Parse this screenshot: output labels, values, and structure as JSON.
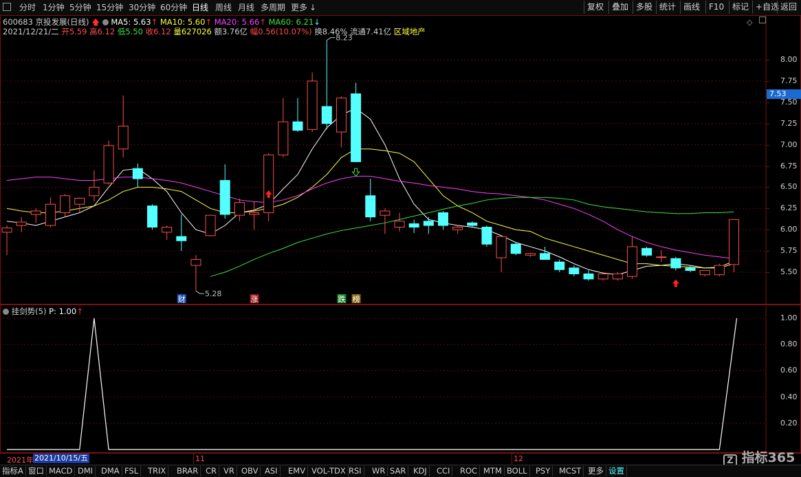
{
  "toolbar": {
    "periods": [
      "分时",
      "1分钟",
      "5分钟",
      "15分钟",
      "30分钟",
      "60分钟",
      "日线",
      "周线",
      "月线",
      "多周期",
      "更多"
    ],
    "active": "日线",
    "right_buttons": [
      "复权",
      "叠加",
      "多股",
      "统计",
      "画线",
      "F10",
      "标记",
      "+自选",
      "返回"
    ]
  },
  "stock": {
    "code_name": "600683 京投发展(日线)",
    "ma5": "MA5: 5.63",
    "ma10": "MA10: 5.60",
    "ma20": "MA20: 5.66",
    "ma60": "MA60: 6.21",
    "date": "2021/12/21/二",
    "open": "开5.59",
    "high": "高6.12",
    "low": "低5.50",
    "close": "收6.12",
    "volume": "量627026",
    "amount": "额3.76亿",
    "change": "幅0.56(10.07%)",
    "turnover": "换8.46%",
    "float": "流通7.41亿",
    "sector": "区域地产"
  },
  "price_axis": {
    "ticks": [
      "8.00",
      "7.75",
      "7.50",
      "7.25",
      "7.00",
      "6.75",
      "6.50",
      "6.25",
      "6.00",
      "5.75",
      "5.50"
    ],
    "current": "7.53"
  },
  "annotations": {
    "high": "8.23",
    "low": "5.28",
    "tags": [
      "财",
      "涨",
      "跌",
      "榜"
    ]
  },
  "indicator": {
    "title": "挂剑势(5)",
    "param": "P: 1.00",
    "ticks": [
      "1.00",
      "0.80",
      "0.60",
      "0.40",
      "0.20"
    ]
  },
  "time_axis": {
    "year": "2021年",
    "cursor_date": "2021/10/15/五",
    "months": [
      "11",
      "12"
    ]
  },
  "bottom_tabs": [
    "指标A",
    "窗口",
    "MACD",
    "DMI",
    "DMA",
    "FSL",
    "TRIX",
    "BRAR",
    "CR",
    "VR",
    "OBV",
    "ASI",
    "EMV",
    "VOL-TDX",
    "RSI",
    "WR",
    "SAR",
    "KDJ",
    "CCI",
    "ROC",
    "MTM",
    "BOLL",
    "PSY",
    "MCST",
    "更多",
    "设置"
  ],
  "watermark": "指标365",
  "colors": {
    "up": "#ff4d4d",
    "down": "#54ffff",
    "ma5": "#ffffff",
    "ma10": "#ffff40",
    "ma20": "#ff40ff",
    "ma60": "#40e040",
    "frame": "#7a1010"
  },
  "chart_data": {
    "type": "candlestick",
    "candles": [
      {
        "o": 5.97,
        "h": 6.05,
        "l": 5.7,
        "c": 6.02
      },
      {
        "o": 6.05,
        "h": 6.15,
        "l": 5.97,
        "c": 6.09
      },
      {
        "o": 6.18,
        "h": 6.25,
        "l": 6.08,
        "c": 6.22
      },
      {
        "o": 6.05,
        "h": 6.38,
        "l": 6.03,
        "c": 6.3
      },
      {
        "o": 6.2,
        "h": 6.42,
        "l": 6.15,
        "c": 6.4
      },
      {
        "o": 6.3,
        "h": 6.38,
        "l": 6.2,
        "c": 6.37
      },
      {
        "o": 6.4,
        "h": 6.7,
        "l": 6.33,
        "c": 6.5
      },
      {
        "o": 6.55,
        "h": 7.05,
        "l": 6.53,
        "c": 6.99
      },
      {
        "o": 6.95,
        "h": 7.58,
        "l": 6.85,
        "c": 7.22
      },
      {
        "o": 6.72,
        "h": 6.78,
        "l": 6.5,
        "c": 6.6
      },
      {
        "o": 6.28,
        "h": 6.3,
        "l": 6.0,
        "c": 6.03
      },
      {
        "o": 5.97,
        "h": 6.05,
        "l": 5.88,
        "c": 6.03
      },
      {
        "o": 5.92,
        "h": 6.18,
        "l": 5.75,
        "c": 5.87
      },
      {
        "o": 5.58,
        "h": 5.7,
        "l": 5.28,
        "c": 5.65
      },
      {
        "o": 5.93,
        "h": 6.1,
        "l": 5.92,
        "c": 6.17
      },
      {
        "o": 6.58,
        "h": 6.77,
        "l": 6.13,
        "c": 6.18
      },
      {
        "o": 6.17,
        "h": 6.37,
        "l": 6.1,
        "c": 6.32
      },
      {
        "o": 6.18,
        "h": 6.33,
        "l": 6.0,
        "c": 6.2
      },
      {
        "o": 6.2,
        "h": 6.9,
        "l": 6.1,
        "c": 6.88
      },
      {
        "o": 6.88,
        "h": 7.55,
        "l": 6.85,
        "c": 7.27
      },
      {
        "o": 7.27,
        "h": 7.55,
        "l": 7.15,
        "c": 7.17
      },
      {
        "o": 7.18,
        "h": 7.85,
        "l": 7.15,
        "c": 7.75
      },
      {
        "o": 7.45,
        "h": 8.23,
        "l": 7.18,
        "c": 7.25
      },
      {
        "o": 7.15,
        "h": 7.57,
        "l": 6.97,
        "c": 7.55
      },
      {
        "o": 7.6,
        "h": 7.73,
        "l": 6.8,
        "c": 6.8
      },
      {
        "o": 6.4,
        "h": 6.6,
        "l": 6.1,
        "c": 6.15
      },
      {
        "o": 6.17,
        "h": 6.25,
        "l": 5.95,
        "c": 6.22
      },
      {
        "o": 6.03,
        "h": 6.2,
        "l": 5.98,
        "c": 6.1
      },
      {
        "o": 6.07,
        "h": 6.12,
        "l": 5.96,
        "c": 6.03
      },
      {
        "o": 6.1,
        "h": 6.15,
        "l": 5.95,
        "c": 6.05
      },
      {
        "o": 6.2,
        "h": 6.22,
        "l": 6.0,
        "c": 6.05
      },
      {
        "o": 6.0,
        "h": 6.05,
        "l": 5.95,
        "c": 6.03
      },
      {
        "o": 6.08,
        "h": 6.1,
        "l": 6.03,
        "c": 6.05
      },
      {
        "o": 6.03,
        "h": 6.05,
        "l": 5.8,
        "c": 5.83
      },
      {
        "o": 5.67,
        "h": 5.87,
        "l": 5.5,
        "c": 5.92
      },
      {
        "o": 5.83,
        "h": 5.85,
        "l": 5.7,
        "c": 5.72
      },
      {
        "o": 5.7,
        "h": 5.73,
        "l": 5.68,
        "c": 5.72
      },
      {
        "o": 5.72,
        "h": 5.8,
        "l": 5.67,
        "c": 5.65
      },
      {
        "o": 5.62,
        "h": 5.65,
        "l": 5.5,
        "c": 5.53
      },
      {
        "o": 5.55,
        "h": 5.58,
        "l": 5.45,
        "c": 5.48
      },
      {
        "o": 5.48,
        "h": 5.52,
        "l": 5.4,
        "c": 5.42
      },
      {
        "o": 5.42,
        "h": 5.5,
        "l": 5.4,
        "c": 5.48
      },
      {
        "o": 5.42,
        "h": 5.5,
        "l": 5.4,
        "c": 5.48
      },
      {
        "o": 5.45,
        "h": 5.92,
        "l": 5.42,
        "c": 5.8
      },
      {
        "o": 5.78,
        "h": 5.8,
        "l": 5.68,
        "c": 5.7
      },
      {
        "o": 5.68,
        "h": 5.76,
        "l": 5.62,
        "c": 5.68
      },
      {
        "o": 5.66,
        "h": 5.68,
        "l": 5.52,
        "c": 5.55
      },
      {
        "o": 5.55,
        "h": 5.58,
        "l": 5.5,
        "c": 5.52
      },
      {
        "o": 5.47,
        "h": 5.52,
        "l": 5.45,
        "c": 5.52
      },
      {
        "o": 5.47,
        "h": 5.6,
        "l": 5.45,
        "c": 5.58
      },
      {
        "o": 5.59,
        "h": 6.12,
        "l": 5.5,
        "c": 6.12
      }
    ],
    "ma5": [
      6.1,
      6.08,
      6.05,
      6.1,
      6.15,
      6.2,
      6.28,
      6.5,
      6.7,
      6.72,
      6.6,
      6.45,
      6.2,
      6.0,
      5.95,
      6.05,
      6.2,
      6.23,
      6.3,
      6.48,
      6.65,
      6.95,
      7.2,
      7.35,
      7.43,
      7.3,
      7.0,
      6.6,
      6.3,
      6.12,
      6.08,
      6.05,
      6.03,
      6.0,
      5.93,
      5.85,
      5.8,
      5.75,
      5.68,
      5.6,
      5.53,
      5.49,
      5.47,
      5.52,
      5.57,
      5.58,
      5.6,
      5.58,
      5.55,
      5.56,
      5.63
    ],
    "ma10": [
      6.25,
      6.22,
      6.2,
      6.2,
      6.22,
      6.25,
      6.28,
      6.35,
      6.45,
      6.5,
      6.5,
      6.48,
      6.45,
      6.35,
      6.25,
      6.2,
      6.2,
      6.22,
      6.25,
      6.3,
      6.38,
      6.5,
      6.65,
      6.85,
      6.95,
      6.95,
      6.93,
      6.9,
      6.8,
      6.6,
      6.4,
      6.28,
      6.2,
      6.1,
      6.05,
      6.0,
      5.98,
      5.9,
      5.85,
      5.8,
      5.75,
      5.7,
      5.65,
      5.6,
      5.6,
      5.58,
      5.57,
      5.56,
      5.55,
      5.55,
      5.6
    ],
    "ma20": [
      6.58,
      6.6,
      6.62,
      6.62,
      6.6,
      6.58,
      6.58,
      6.6,
      6.62,
      6.62,
      6.6,
      6.58,
      6.55,
      6.5,
      6.45,
      6.4,
      6.35,
      6.33,
      6.32,
      6.35,
      6.4,
      6.48,
      6.55,
      6.6,
      6.63,
      6.63,
      6.6,
      6.57,
      6.55,
      6.52,
      6.5,
      6.48,
      6.45,
      6.43,
      6.42,
      6.4,
      6.38,
      6.35,
      6.3,
      6.25,
      6.18,
      6.1,
      6.0,
      5.92,
      5.85,
      5.8,
      5.76,
      5.73,
      5.7,
      5.68,
      5.66
    ],
    "ma60": [
      null,
      null,
      null,
      null,
      null,
      null,
      null,
      null,
      null,
      null,
      null,
      null,
      null,
      null,
      5.45,
      5.5,
      5.57,
      5.65,
      5.72,
      5.78,
      5.85,
      5.9,
      5.95,
      5.99,
      6.02,
      6.05,
      6.08,
      6.12,
      6.16,
      6.2,
      6.24,
      6.28,
      6.31,
      6.35,
      6.37,
      6.38,
      6.38,
      6.38,
      6.37,
      6.35,
      6.3,
      6.27,
      6.25,
      6.23,
      6.21,
      6.2,
      6.19,
      6.19,
      6.2,
      6.2,
      6.21
    ],
    "y_range": [
      5.28,
      8.23
    ],
    "indicator_series": [
      0,
      0,
      0,
      0,
      0,
      0,
      1,
      0,
      0,
      0,
      0,
      0,
      0,
      0,
      0,
      0,
      0,
      0,
      0,
      0,
      0,
      0,
      0,
      0,
      0,
      0,
      0,
      0,
      0,
      0,
      0,
      0,
      0,
      0,
      0,
      0,
      0,
      0,
      0,
      0,
      0,
      0,
      0,
      0,
      0,
      0,
      0,
      0,
      0,
      0,
      1
    ]
  }
}
